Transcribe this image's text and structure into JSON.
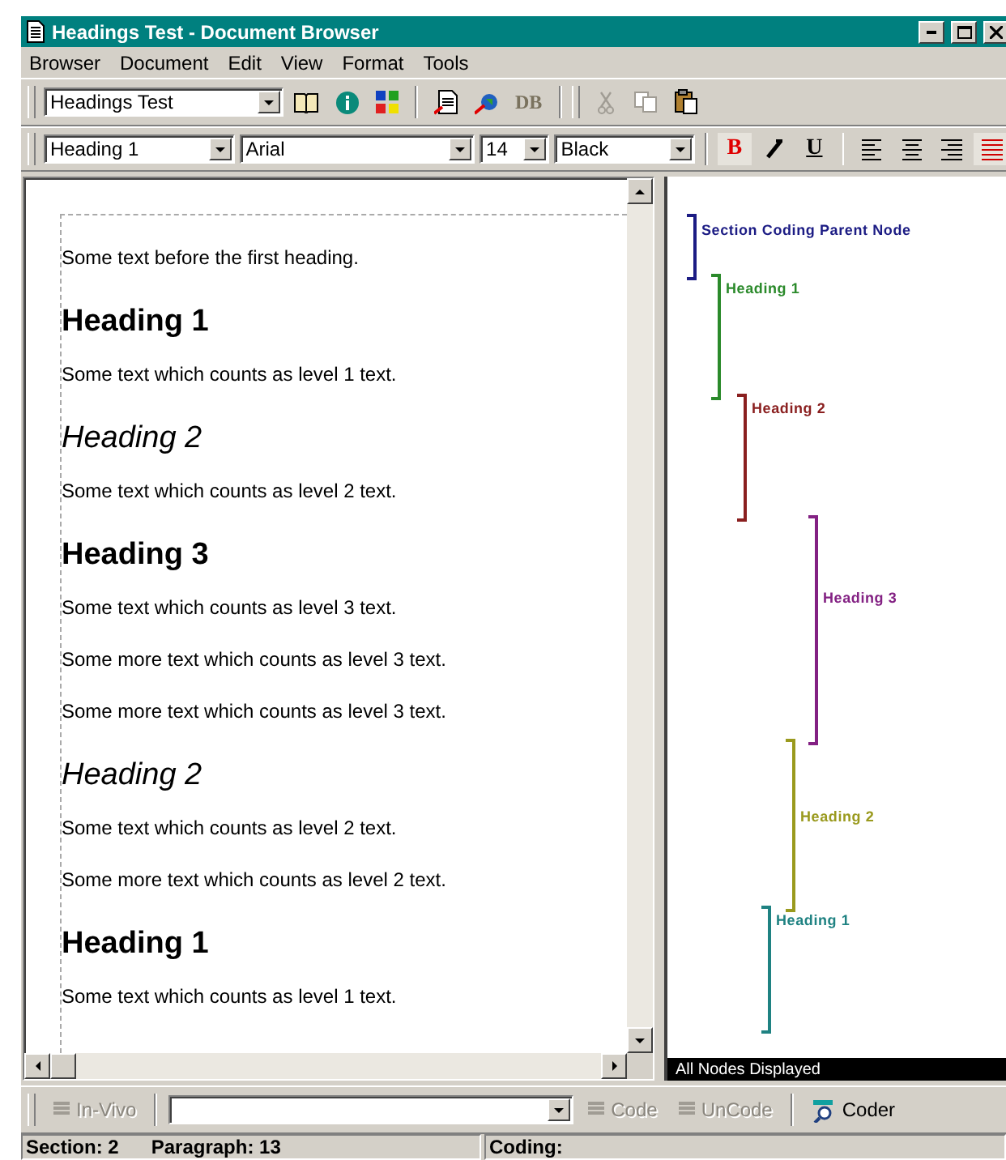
{
  "window": {
    "title": "Headings Test - Document Browser"
  },
  "menu": [
    "Browser",
    "Document",
    "Edit",
    "View",
    "Format",
    "Tools"
  ],
  "toolbar": {
    "document": "Headings Test",
    "db": "DB"
  },
  "format_bar": {
    "style": "Heading 1",
    "font": "Arial",
    "size": "14",
    "foreground": "Black",
    "bold": {
      "label": "B",
      "on": true
    },
    "underline": {
      "label": "U",
      "on": false
    },
    "alignments": [
      {
        "kind": "left",
        "selected": false
      },
      {
        "kind": "center",
        "selected": false
      },
      {
        "kind": "right",
        "selected": false
      },
      {
        "kind": "justify",
        "selected": true
      }
    ]
  },
  "document": [
    {
      "kind": "text",
      "text": "Some text before the first heading."
    },
    {
      "kind": "h1",
      "text": "Heading 1"
    },
    {
      "kind": "text",
      "text": "Some text which counts as level 1 text."
    },
    {
      "kind": "h2",
      "text": "Heading 2"
    },
    {
      "kind": "text",
      "text": "Some text which counts as level 2 text."
    },
    {
      "kind": "h3",
      "text": "Heading 3"
    },
    {
      "kind": "text",
      "text": "Some text which counts as level 3 text."
    },
    {
      "kind": "text",
      "text": "Some more text which counts as level 3 text."
    },
    {
      "kind": "text",
      "text": "Some more text which counts as level 3 text."
    },
    {
      "kind": "h2",
      "text": "Heading 2"
    },
    {
      "kind": "text",
      "text": "Some text which counts as level 2 text."
    },
    {
      "kind": "text",
      "text": "Some more text which counts as level 2 text."
    },
    {
      "kind": "h1",
      "text": "Heading 1"
    },
    {
      "kind": "text",
      "text": "Some text which counts as level 1 text."
    }
  ],
  "coding_stripes": [
    {
      "label": "Section Coding Parent Node",
      "color": "#1c1c84"
    },
    {
      "label": "Heading 1",
      "color": "#2b8a2b"
    },
    {
      "label": "Heading 2",
      "color": "#8a1f1f"
    },
    {
      "label": "Heading 3",
      "color": "#832183"
    },
    {
      "label": "Heading 2",
      "color": "#9a9a1e"
    },
    {
      "label": "Heading 1",
      "color": "#1f8282"
    }
  ],
  "stripes_footer": "All Nodes Displayed",
  "coding_bar": {
    "in_vivo": {
      "label": "In-Vivo",
      "disabled": true
    },
    "code": {
      "label": "Code",
      "disabled": true
    },
    "uncode": {
      "label": "UnCode",
      "disabled": true
    },
    "coder": {
      "label": "Coder",
      "disabled": false
    }
  },
  "status_bar": {
    "section": "Section: 2",
    "paragraph": "Paragraph: 13",
    "coding": "Coding:"
  }
}
